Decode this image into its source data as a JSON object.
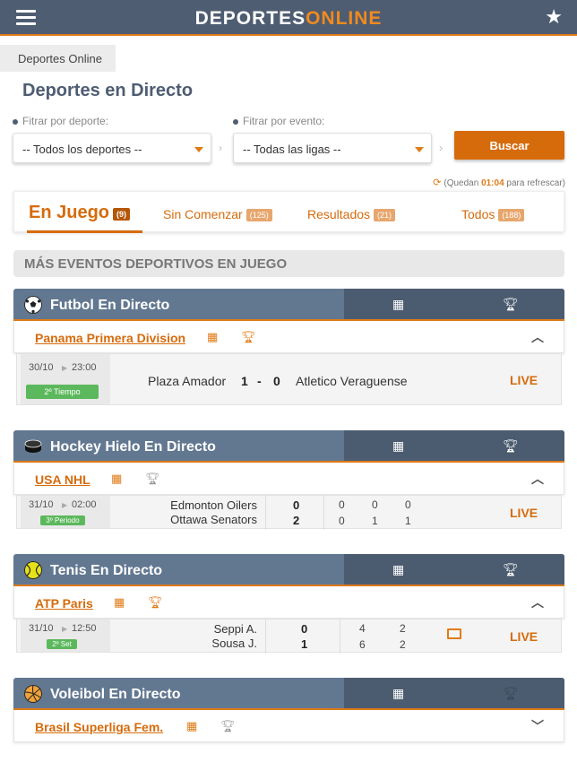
{
  "header": {
    "logo_main": "DEPORTES",
    "logo_accent": "ONLINE"
  },
  "breadcrumb": "Deportes Online",
  "page_title": "Deportes en Directo",
  "filters": {
    "sport_label": "Fitrar por deporte:",
    "sport_value": "-- Todos los deportes --",
    "event_label": "Fitrar por evento:",
    "event_value": "-- Todas las ligas --",
    "search_label": "Buscar"
  },
  "refresh": {
    "prefix": "(Quedan",
    "time": "01:04",
    "suffix": "para refrescar)"
  },
  "tabs": [
    {
      "label": "En Juego",
      "count": "(9)",
      "active": true
    },
    {
      "label": "Sin Comenzar",
      "count": "(125)"
    },
    {
      "label": "Resultados",
      "count": "(21)"
    },
    {
      "label": "Todos",
      "count": "(188)"
    }
  ],
  "section_title": "MÁS EVENTOS DEPORTIVOS EN JUEGO",
  "sports": [
    {
      "title": "Futbol En Directo",
      "league": "Panama Primera Division",
      "match": {
        "date": "30/10",
        "time": "23:00",
        "status": "2º Tiempo",
        "home": "Plaza Amador",
        "home_score": "1",
        "sep": "-",
        "away_score": "0",
        "away": "Atletico Veraguense",
        "live": "LIVE"
      }
    },
    {
      "title": "Hockey Hielo En Directo",
      "league": "USA NHL",
      "match": {
        "date": "31/10",
        "time": "02:00",
        "status": "3º Periodo",
        "home": "Edmonton Oilers",
        "away": "Ottawa Senators",
        "home_total": "0",
        "away_total": "2",
        "home_periods": [
          "0",
          "0",
          "0"
        ],
        "away_periods": [
          "0",
          "1",
          "1"
        ],
        "live": "LIVE"
      }
    },
    {
      "title": "Tenis En Directo",
      "league": "ATP Paris",
      "match": {
        "date": "31/10",
        "time": "12:50",
        "status": "2º Set",
        "home": "Seppi A.",
        "away": "Sousa J.",
        "home_total": "0",
        "away_total": "1",
        "home_sets": [
          "4",
          "2"
        ],
        "away_sets": [
          "6",
          "2"
        ],
        "live": "LIVE"
      }
    },
    {
      "title": "Voleibol En Directo",
      "league": "Brasil Superliga Fem."
    }
  ],
  "colors": {
    "primary": "#4e5d72",
    "accent": "#d66b0c",
    "sport_bar": "#627891",
    "status_green": "#5cb85c"
  }
}
